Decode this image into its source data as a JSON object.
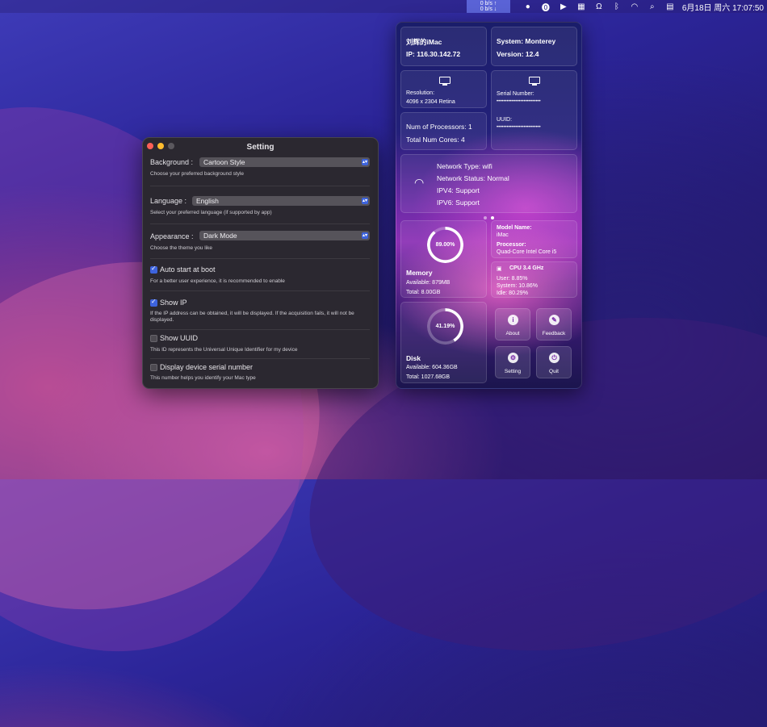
{
  "menubar": {
    "net_up": "0 b/s ↑",
    "net_down": "0 b/s ↓",
    "clock": "6月18日 周六  17:07:50"
  },
  "settings": {
    "title": "Setting",
    "background": {
      "label": "Background :",
      "value": "Cartoon Style",
      "desc": "Choose your preferred background style"
    },
    "language": {
      "label": "Language :",
      "value": "English",
      "desc": "Select your preferred language (if supported by app)"
    },
    "appearance": {
      "label": "Appearance :",
      "value": "Dark Mode",
      "desc": "Choose the theme you like"
    },
    "auto_start": {
      "label": "Auto start at boot",
      "checked": true,
      "desc": "For a better user experience, it is recommended to enable"
    },
    "show_ip": {
      "label": "Show IP",
      "checked": true,
      "desc": "If the IP address can be obtained, it will be displayed. If the acquisition fails, it will not be displayed."
    },
    "show_uuid": {
      "label": "Show UUID",
      "checked": false,
      "desc": "This ID represents the Universal Unique Identifier for my device"
    },
    "serial": {
      "label": "Display device serial number",
      "checked": false,
      "desc": "This number helps you identify your Mac type"
    }
  },
  "widget": {
    "host_name": "刘辉的iMac",
    "ip": "IP: 116.30.142.72",
    "system": "System: Monterey",
    "version": "Version: 12.4",
    "resolution_label": "Resolution:",
    "resolution_value": "4096 x 2304 Retina",
    "serial_label": "Serial Number:",
    "serial_value": "••••••••••••••••••••••••••",
    "processors": "Num of Processors: 1",
    "cores": "Total Num Cores: 4",
    "uuid_label": "UUID:",
    "uuid_value": "••••••••••••••••••••••••••",
    "network": {
      "type": "Network Type:   wifi",
      "status": "Network Status:    Normal",
      "ipv4": "IPV4:    Support",
      "ipv6": "IPV6:    Support"
    },
    "memory": {
      "percent_label": "89.00%",
      "percent": 89.0,
      "title": "Memory",
      "available": "Available: 879MB",
      "total": "Total: 8.00GB"
    },
    "model": {
      "name_label": "Model Name:",
      "name_value": "iMac",
      "processor_label": "Processor:",
      "processor_value": "Quad-Core Intel Core i5"
    },
    "cpu": {
      "title": "CPU   3.4 GHz",
      "user": "User:   8.85%",
      "system": "System:   10.86%",
      "idle": "Idle:   80.29%"
    },
    "disk": {
      "percent_label": "41.19%",
      "percent": 41.19,
      "title": "Disk",
      "available": "Available: 604.36GB",
      "total": "Total: 1027.68GB"
    },
    "buttons": {
      "about": "About",
      "feedback": "Feedback",
      "setting": "Setting",
      "quit": "Quit"
    }
  }
}
